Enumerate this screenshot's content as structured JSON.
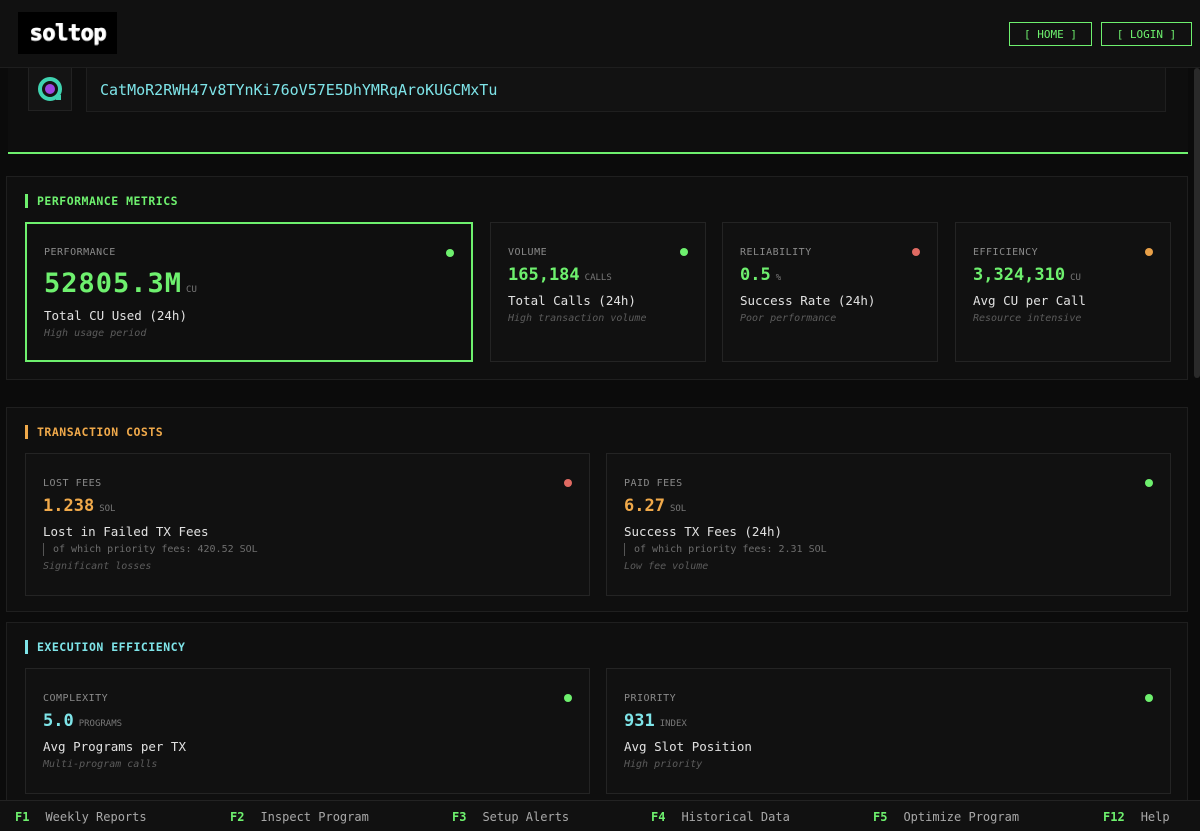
{
  "header": {
    "logo_text": "soltop",
    "home_label": "[ HOME ]",
    "login_label": "[ LOGIN ]"
  },
  "program": {
    "id": "CatMoR2RWH47v8TYnKi76oV57E5DhYMRqAroKUGCMxTu"
  },
  "colors": {
    "accent": "#6ef06e",
    "orange": "#f0a94a",
    "cyan": "#7ee4e8",
    "red": "#e06a62"
  },
  "performance": {
    "title": "PERFORMANCE METRICS",
    "main": {
      "label": "PERFORMANCE",
      "value": "52805.3M",
      "unit": "CU",
      "desc": "Total CU Used (24h)",
      "sub": "High usage period"
    },
    "volume": {
      "label": "VOLUME",
      "value": "165,184",
      "unit": "CALLS",
      "desc": "Total Calls (24h)",
      "sub": "High transaction volume"
    },
    "reliability": {
      "label": "RELIABILITY",
      "value": "0.5",
      "unit": "%",
      "desc": "Success Rate (24h)",
      "sub": "Poor performance"
    },
    "efficiency": {
      "label": "EFFICIENCY",
      "value": "3,324,310",
      "unit": "CU",
      "desc": "Avg CU per Call",
      "sub": "Resource intensive"
    }
  },
  "costs": {
    "title": "TRANSACTION COSTS",
    "lost": {
      "label": "LOST FEES",
      "value": "1.238",
      "unit": "SOL",
      "desc": "Lost in Failed TX Fees",
      "note": "of which priority fees: 420.52 SOL",
      "sub": "Significant losses"
    },
    "paid": {
      "label": "PAID FEES",
      "value": "6.27",
      "unit": "SOL",
      "desc": "Success TX Fees (24h)",
      "note": "of which priority fees: 2.31 SOL",
      "sub": "Low fee volume"
    }
  },
  "execution": {
    "title": "EXECUTION EFFICIENCY",
    "complexity": {
      "label": "COMPLEXITY",
      "value": "5.0",
      "unit": "PROGRAMS",
      "desc": "Avg Programs per TX",
      "sub": "Multi-program calls"
    },
    "priority": {
      "label": "PRIORITY",
      "value": "931",
      "unit": "INDEX",
      "desc": "Avg Slot Position",
      "sub": "High priority"
    }
  },
  "footer": {
    "keys": [
      {
        "key": "F1",
        "label": "Weekly Reports"
      },
      {
        "key": "F2",
        "label": "Inspect Program"
      },
      {
        "key": "F3",
        "label": "Setup Alerts"
      },
      {
        "key": "F4",
        "label": "Historical Data"
      },
      {
        "key": "F5",
        "label": "Optimize Program"
      },
      {
        "key": "F12",
        "label": "Help"
      }
    ]
  }
}
